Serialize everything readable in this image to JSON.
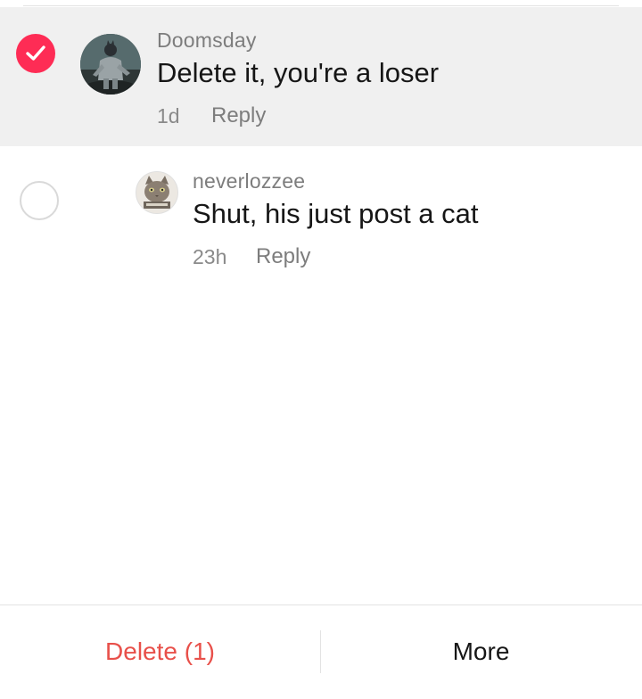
{
  "comments": [
    {
      "username": "Doomsday",
      "text": "Delete it, you're a loser",
      "time": "1d",
      "reply_label": "Reply",
      "selected": true,
      "avatar_icon": "doomsday-avatar"
    },
    {
      "username": "neverlozzee",
      "text": "Shut, his just post a cat",
      "time": "23h",
      "reply_label": "Reply",
      "selected": false,
      "avatar_icon": "cat-avatar"
    }
  ],
  "bottom_bar": {
    "delete_label": "Delete (1)",
    "more_label": "More"
  },
  "colors": {
    "accent": "#fe2c55",
    "delete_text": "#e8504a",
    "selected_row_bg": "#f0f0f0"
  }
}
